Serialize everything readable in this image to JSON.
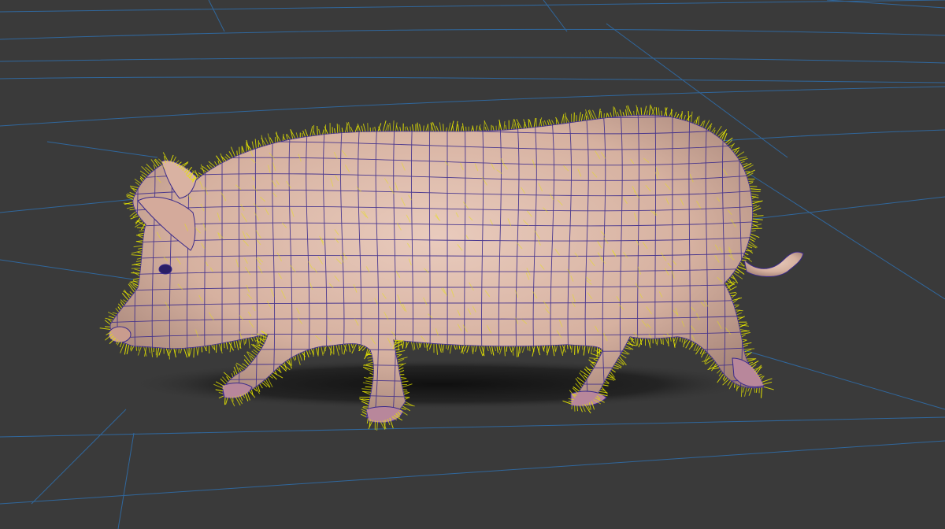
{
  "scene": {
    "background_color": "#3a3a3a",
    "grid_color": "#2f6fae",
    "wireframe_color": "#3a2a8c",
    "hair_color": "#e6e600",
    "skin_color": "#d9b7a6",
    "shadow_color": "#111111",
    "subject": "pig-model",
    "view": "perspective",
    "display_mode": "shaded-with-wireframe",
    "hair_guides_visible": true
  }
}
